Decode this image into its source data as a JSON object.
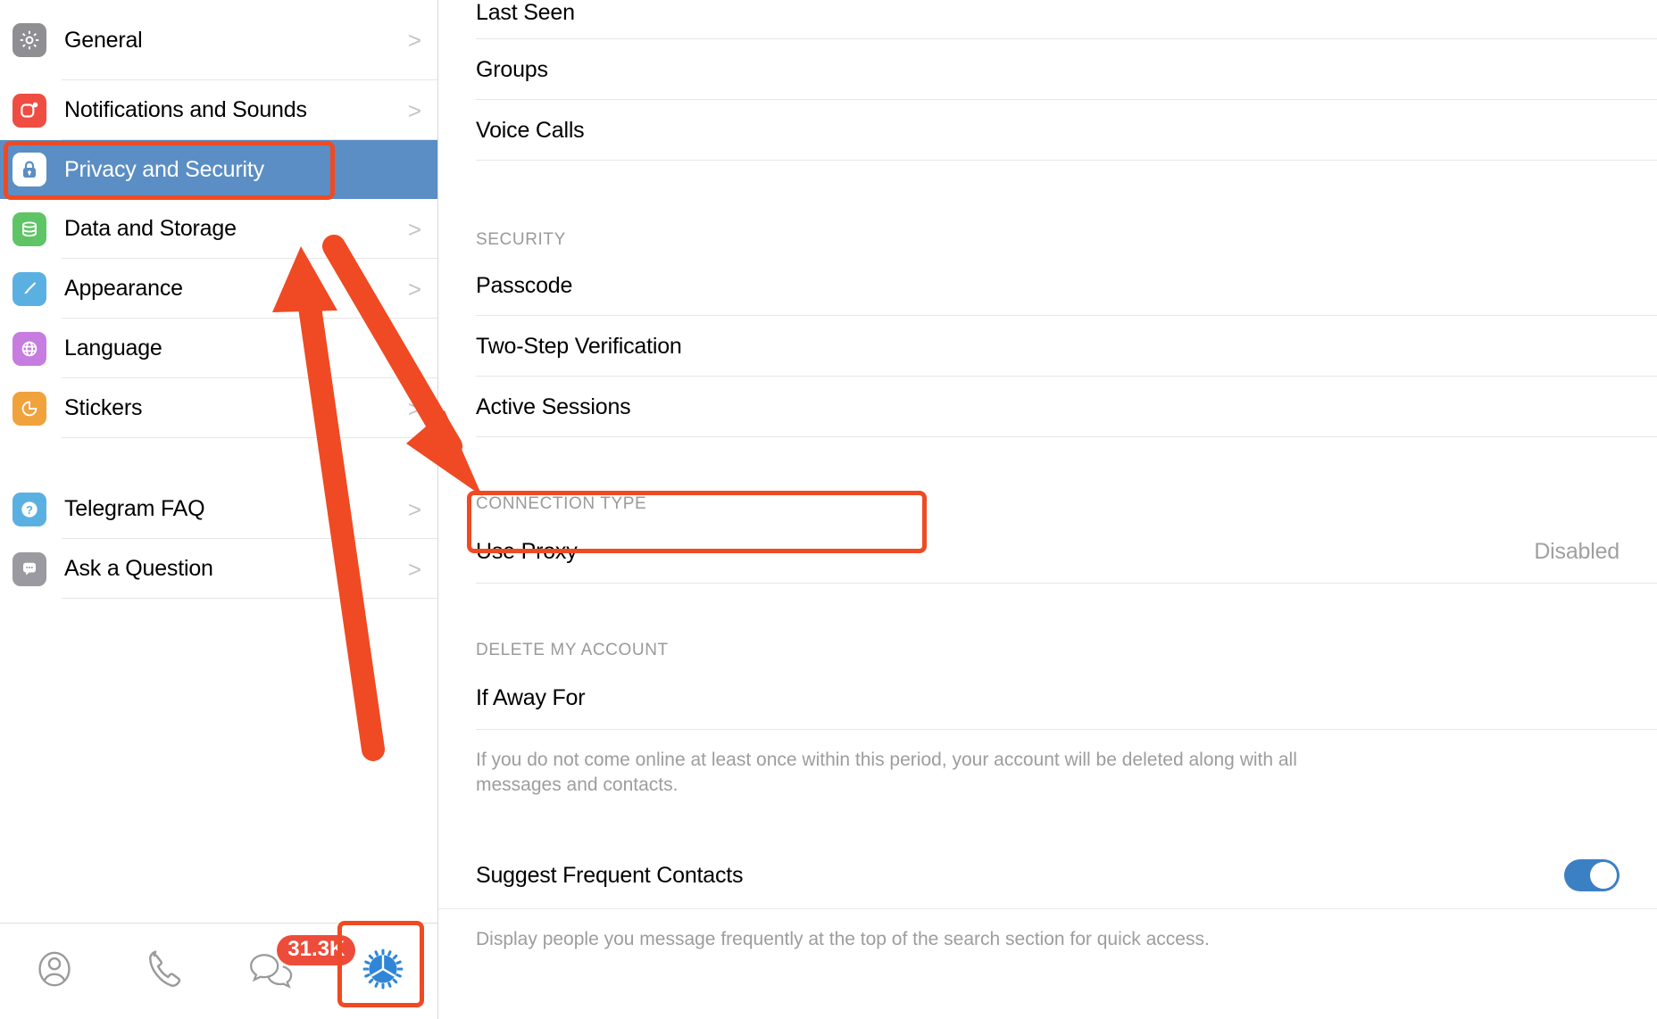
{
  "sidebar": {
    "items": [
      {
        "label": "General",
        "icon": "gear-icon",
        "color": "#8e8e93",
        "chevron": ">",
        "selected": false
      },
      {
        "label": "Notifications and Sounds",
        "icon": "bell-badge-icon",
        "color": "#ef4c42",
        "chevron": ">",
        "selected": false
      },
      {
        "label": "Privacy and Security",
        "icon": "lock-icon",
        "color": "#5b8ec4",
        "chevron": "",
        "selected": true
      },
      {
        "label": "Data and Storage",
        "icon": "database-icon",
        "color": "#5fc466",
        "chevron": ">",
        "selected": false
      },
      {
        "label": "Appearance",
        "icon": "paintbrush-icon",
        "color": "#5bb0e2",
        "chevron": ">",
        "selected": false
      },
      {
        "label": "Language",
        "icon": "globe-icon",
        "color": "#c77ce0",
        "chevron": "",
        "selected": false
      },
      {
        "label": "Stickers",
        "icon": "sticker-icon",
        "color": "#f0a23c",
        "chevron": ">",
        "selected": false
      }
    ],
    "help_items": [
      {
        "label": "Telegram FAQ",
        "icon": "question-icon",
        "color": "#5bb0e2",
        "chevron": ">"
      },
      {
        "label": "Ask a Question",
        "icon": "chat-bubble-icon",
        "color": "#9a9aa0",
        "chevron": ">"
      }
    ],
    "tabbar": {
      "tabs": [
        {
          "name": "contacts-tab",
          "icon": "person-circle-icon",
          "badge": ""
        },
        {
          "name": "calls-tab",
          "icon": "phone-icon",
          "badge": ""
        },
        {
          "name": "chats-tab",
          "icon": "chats-icon",
          "badge": "31.3K"
        },
        {
          "name": "settings-tab",
          "icon": "settings-gear-icon",
          "badge": ""
        }
      ]
    }
  },
  "main": {
    "privacy_rows": [
      {
        "label": "Last Seen",
        "value": ""
      },
      {
        "label": "Groups",
        "value": ""
      },
      {
        "label": "Voice Calls",
        "value": ""
      }
    ],
    "security": {
      "header": "SECURITY",
      "rows": [
        {
          "label": "Passcode",
          "value": ""
        },
        {
          "label": "Two-Step Verification",
          "value": ""
        },
        {
          "label": "Active Sessions",
          "value": ""
        }
      ]
    },
    "connection": {
      "header": "CONNECTION TYPE",
      "rows": [
        {
          "label": "Use Proxy",
          "value": "Disabled"
        }
      ]
    },
    "delete_account": {
      "header": "DELETE MY ACCOUNT",
      "rows": [
        {
          "label": "If Away For",
          "value": ""
        }
      ],
      "note": "If you do not come online at least once within this period, your account will be deleted along with all messages and contacts."
    },
    "suggest": {
      "label": "Suggest Frequent Contacts",
      "toggle_on": true,
      "note": "Display people you message frequently at the top of the search section for quick access."
    }
  },
  "annotations": {
    "highlight_color": "#ef4a23",
    "boxes": [
      "privacy-and-security-highlight",
      "use-proxy-highlight",
      "settings-tab-highlight"
    ],
    "arrows": [
      "arrow-to-settings-tab",
      "arrow-to-use-proxy"
    ]
  }
}
